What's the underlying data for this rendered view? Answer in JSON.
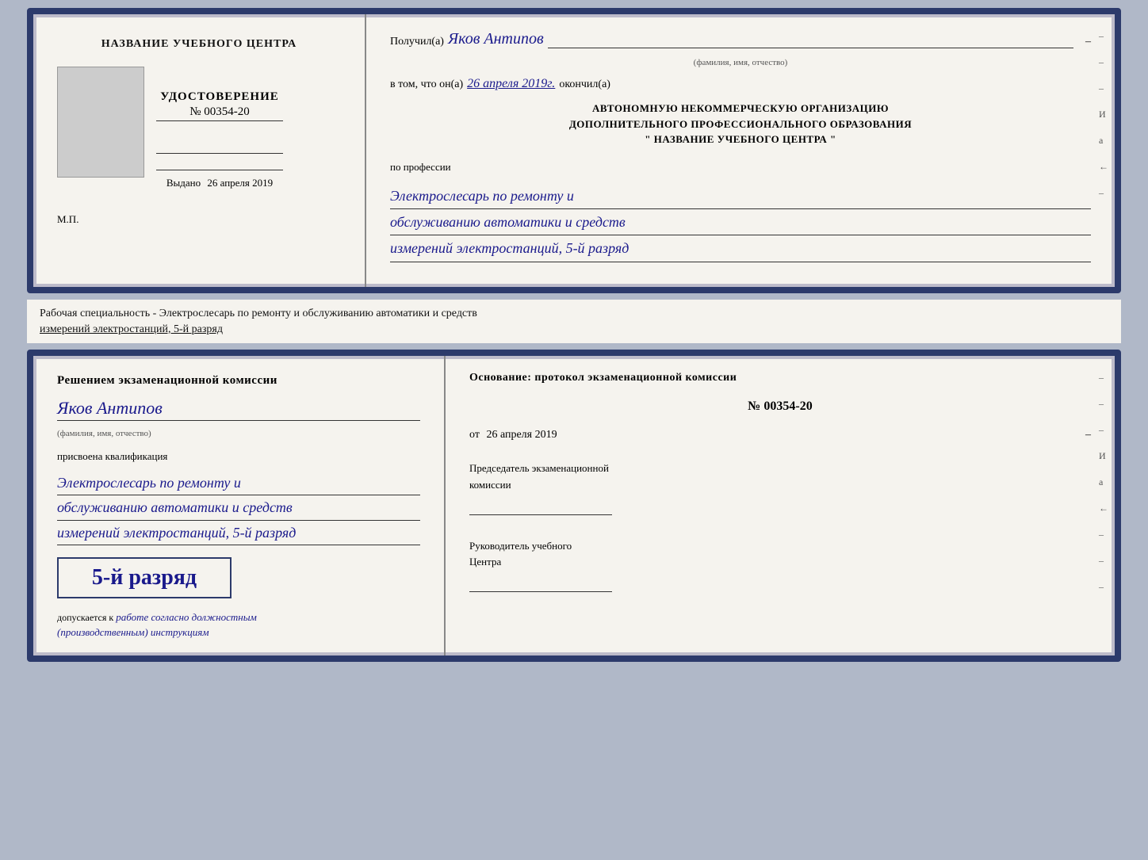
{
  "top": {
    "left": {
      "center_title": "НАЗВАНИЕ УЧЕБНОГО ЦЕНТРА",
      "cert_label": "УДОСТОВЕРЕНИЕ",
      "cert_number": "№ 00354-20",
      "vydano": "Выдано",
      "vydano_date": "26 апреля 2019",
      "mp": "М.П."
    },
    "right": {
      "poluchil_prefix": "Получил(а)",
      "recipient_name": "Яков Антипов",
      "fio_label": "(фамилия, имя, отчество)",
      "v_tom_prefix": "в том, что он(а)",
      "v_tom_date": "26 апреля 2019г.",
      "okonchil": "окончил(а)",
      "org_line1": "АВТОНОМНУЮ НЕКОММЕРЧЕСКУЮ ОРГАНИЗАЦИЮ",
      "org_line2": "ДОПОЛНИТЕЛЬНОГО ПРОФЕССИОНАЛЬНОГО ОБРАЗОВАНИЯ",
      "org_line3": "\"   НАЗВАНИЕ УЧЕБНОГО ЦЕНТРА   \"",
      "po_professii": "по профессии",
      "profession_line1": "Электрослесарь по ремонту и",
      "profession_line2": "обслуживанию автоматики и средств",
      "profession_line3": "измерений электростанций, 5-й разряд"
    },
    "side_marks": [
      "-",
      "-",
      "-",
      "И",
      "а",
      "←",
      "-"
    ]
  },
  "middle": {
    "text": "Рабочая специальность - Электрослесарь по ремонту и обслуживанию автоматики и средств",
    "text2": "измерений электростанций, 5-й разряд"
  },
  "bottom": {
    "left": {
      "komissia_title": "Решением экзаменационной комиссии",
      "name": "Яков Антипов",
      "fio_label": "(фамилия, имя, отчество)",
      "prisvoena": "присвоена квалификация",
      "qual_line1": "Электрослесарь по ремонту и",
      "qual_line2": "обслуживанию автоматики и средств",
      "qual_line3": "измерений электростанций, 5-й разряд",
      "razryad_label": "5-й разряд",
      "dopusk_prefix": "допускается к",
      "dopusk_text": "работе согласно должностным",
      "dopusk_text2": "(производственным) инструкциям"
    },
    "right": {
      "osnovanie": "Основание: протокол экзаменационной комиссии",
      "protocol_number": "№ 00354-20",
      "ot_prefix": "от",
      "ot_date": "26 апреля 2019",
      "predsedatel_line1": "Председатель экзаменационной",
      "predsedatel_line2": "комиссии",
      "rukovoditel_line1": "Руководитель учебного",
      "rukovoditel_line2": "Центра"
    },
    "side_marks": [
      "-",
      "-",
      "-",
      "И",
      "а",
      "←",
      "-",
      "-",
      "-"
    ]
  }
}
